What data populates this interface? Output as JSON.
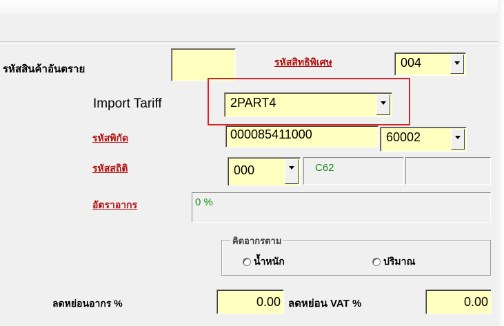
{
  "form": {
    "dangerous_goods_code_label": "รหัสสินค้าอันตราย",
    "dangerous_goods_code_value": "",
    "privilege_code_link": "รหัสสิทธิพิเศษ",
    "privilege_code_value": "004",
    "import_tariff_label": "Import Tariff",
    "import_tariff_value": "2PART4",
    "tariff_code_link": "รหัสพิกัด",
    "tariff_code_value": "000085411000",
    "tariff_subcode_value": "60002",
    "statistics_code_link": "รหัสสถิติ",
    "statistics_code_value": "000",
    "statistics_unit_value": "C62",
    "duty_rate_link": "อัตราอากร",
    "duty_rate_value": "0 %",
    "calc_group_label": "คิดอากรตาม",
    "calc_options": [
      "น้ำหนัก",
      "ปริมาณ"
    ],
    "duty_reduction_label": "ลดหย่อนอากร %",
    "duty_reduction_value": "0.00",
    "vat_reduction_label": "ลดหย่อน VAT %",
    "vat_reduction_value": "0.00"
  },
  "colors": {
    "field_bg": "#ffffc0",
    "link": "#b01010",
    "highlight": "#e02020",
    "panel": "#f0f0f0",
    "unit_text": "#1a8a1a"
  }
}
